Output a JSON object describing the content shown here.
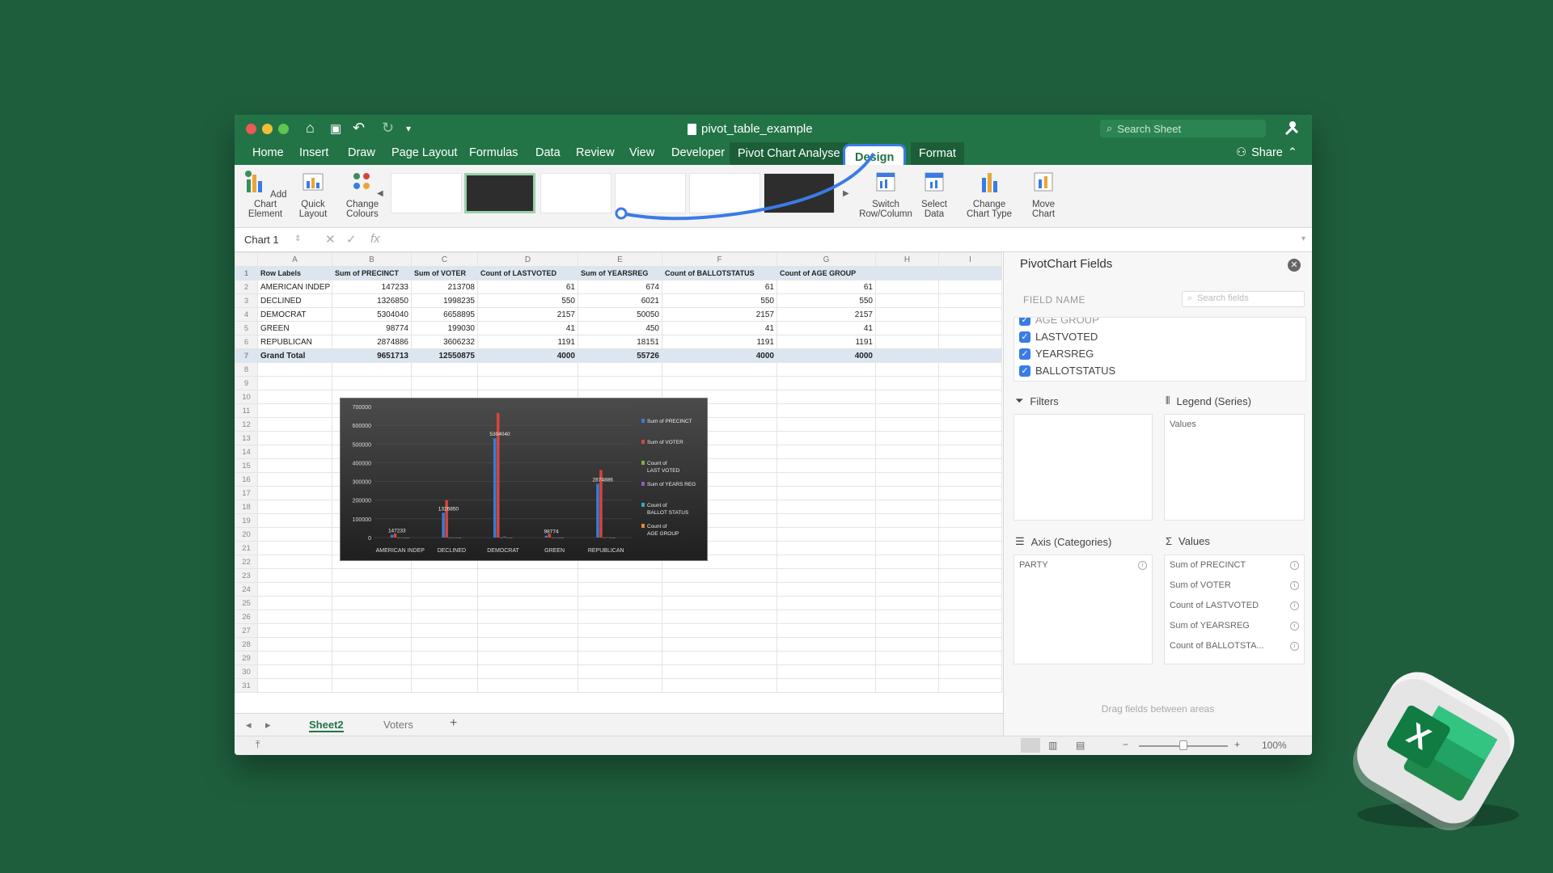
{
  "window": {
    "title": "pivot_table_example",
    "search_placeholder": "Search Sheet"
  },
  "tabs": [
    "Home",
    "Insert",
    "Draw",
    "Page Layout",
    "Formulas",
    "Data",
    "Review",
    "View",
    "Developer"
  ],
  "context_tabs": {
    "analyse": "Pivot Chart Analyse",
    "design": "Design",
    "format": "Format"
  },
  "share_label": "Share",
  "ribbon": {
    "add_chart_element": "Add Chart Element",
    "quick_layout": "Quick Layout",
    "change_colours": "Change Colours",
    "switch_row_column": "Switch Row/Column",
    "select_data": "Select Data",
    "change_chart_type": "Change Chart Type",
    "move_chart": "Move Chart"
  },
  "formula_bar": {
    "name_box": "Chart 1",
    "fx": "fx"
  },
  "sheet": {
    "columns": [
      "A",
      "B",
      "C",
      "D",
      "E",
      "F",
      "G",
      "H",
      "I"
    ],
    "header_row": [
      "Row Labels",
      "Sum of PRECINCT",
      "Sum of VOTER",
      "Count of LASTVOTED",
      "Sum of YEARSREG",
      "Count of BALLOTSTATUS",
      "Count of AGE GROUP"
    ],
    "rows": [
      [
        "AMERICAN INDEP",
        "147233",
        "213708",
        "61",
        "674",
        "61",
        "61"
      ],
      [
        "DECLINED",
        "1326850",
        "1998235",
        "550",
        "6021",
        "550",
        "550"
      ],
      [
        "DEMOCRAT",
        "5304040",
        "6658895",
        "2157",
        "50050",
        "2157",
        "2157"
      ],
      [
        "GREEN",
        "98774",
        "199030",
        "41",
        "450",
        "41",
        "41"
      ],
      [
        "REPUBLICAN",
        "2874886",
        "3606232",
        "1191",
        "18151",
        "1191",
        "1191"
      ]
    ],
    "total_row": [
      "Grand Total",
      "9651713",
      "12550875",
      "4000",
      "55726",
      "4000",
      "4000"
    ]
  },
  "chart_data": {
    "type": "bar",
    "categories": [
      "AMERICAN INDEP",
      "DECLINED",
      "DEMOCRAT",
      "GREEN",
      "REPUBLICAN"
    ],
    "series": [
      {
        "name": "Sum of PRECINCT",
        "values": [
          147233,
          1326850,
          5304040,
          98774,
          2874886
        ],
        "color": "#3d7bd6"
      },
      {
        "name": "Sum of VOTER",
        "values": [
          213708,
          1998235,
          6658895,
          199030,
          3606232
        ],
        "color": "#d6453d"
      },
      {
        "name": "Count of LAST VOTED",
        "values": [
          61,
          550,
          2157,
          41,
          1191
        ],
        "color": "#7fb03a"
      },
      {
        "name": "Sum of YEARS REG",
        "values": [
          674,
          6021,
          50050,
          450,
          18151
        ],
        "color": "#8a5bc4"
      },
      {
        "name": "Count of BALLOT STATUS",
        "values": [
          61,
          550,
          2157,
          41,
          1191
        ],
        "color": "#2fa8c8"
      },
      {
        "name": "Count of AGE GROUP",
        "values": [
          61,
          550,
          2157,
          41,
          1191
        ],
        "color": "#e68a2e"
      }
    ],
    "y_ticks": [
      "0",
      "100000",
      "200000",
      "300000",
      "400000",
      "500000",
      "600000",
      "700000"
    ],
    "ylim": [
      0,
      7000000
    ],
    "data_labels": {
      "AMERICAN INDEP": "147233",
      "DECLINED": "1326850",
      "DEMOCRAT": "5304040",
      "GREEN": "98774",
      "REPUBLICAN": "2874886"
    },
    "legend_position": "right"
  },
  "sheet_tabs": [
    "Sheet2",
    "Voters"
  ],
  "add_sheet": "+",
  "zoom": "100%",
  "pivot_pane": {
    "title": "PivotChart Fields",
    "field_name_label": "FIELD NAME",
    "search_placeholder": "Search fields",
    "fields": [
      "AGE GROUP",
      "LASTVOTED",
      "YEARSREG",
      "BALLOTSTATUS"
    ],
    "filters_label": "Filters",
    "legend_label": "Legend (Series)",
    "legend_items": [
      "Values"
    ],
    "axis_label": "Axis (Categories)",
    "axis_items": [
      "PARTY"
    ],
    "values_label": "Values",
    "values_items": [
      "Sum of PRECINCT",
      "Sum of VOTER",
      "Count of LASTVOTED",
      "Sum of YEARSREG",
      "Count of BALLOTSTA..."
    ],
    "drag_hint": "Drag fields between areas"
  }
}
